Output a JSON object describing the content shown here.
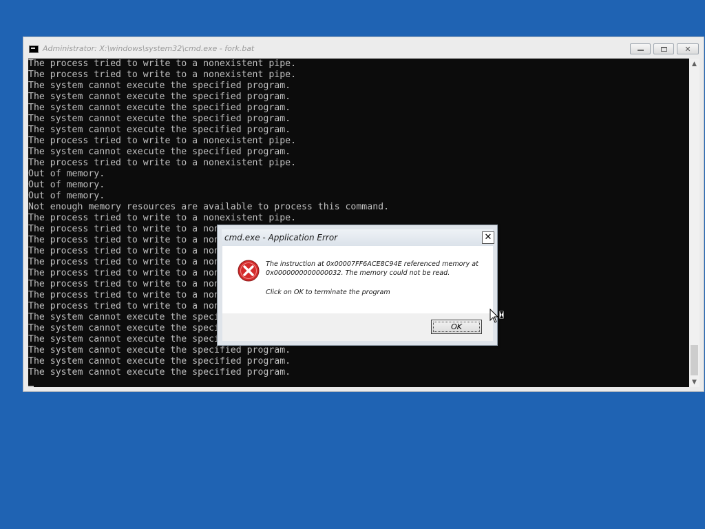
{
  "cmd_window": {
    "title": "Administrator: X:\\windows\\system32\\cmd.exe - fork.bat",
    "lines": [
      "The process tried to write to a nonexistent pipe.",
      "The process tried to write to a nonexistent pipe.",
      "The system cannot execute the specified program.",
      "The system cannot execute the specified program.",
      "The system cannot execute the specified program.",
      "The system cannot execute the specified program.",
      "The system cannot execute the specified program.",
      "The process tried to write to a nonexistent pipe.",
      "The system cannot execute the specified program.",
      "The process tried to write to a nonexistent pipe.",
      "Out of memory.",
      "Out of memory.",
      "Out of memory.",
      "Not enough memory resources are available to process this command.",
      "The process tried to write to a nonexistent pipe.",
      "The process tried to write to a nonexistent pipe.",
      "The process tried to write to a nonexistent pipe.",
      "The process tried to write to a nonexistent pipe.",
      "The process tried to write to a nonexistent pipe.",
      "The process tried to write to a nonexistent pipe.",
      "The process tried to write to a nonexistent pipe.",
      "The process tried to write to a nonexistent pipe.",
      "The process tried to write to a nonexistent pipe.",
      "The system cannot execute the specified program.",
      "The system cannot execute the specified program.",
      "The system cannot execute the specified program.",
      "The system cannot execute the specified program.",
      "The system cannot execute the specified program.",
      "The system cannot execute the specified program."
    ]
  },
  "dialog": {
    "title": "cmd.exe - Application Error",
    "close_label": "✕",
    "message": "The instruction at 0x00007FF6ACE8C94E referenced memory at 0x0000000000000032. The memory could not be read.",
    "instruction": "Click on OK to terminate the program",
    "ok_label": "OK"
  },
  "colors": {
    "desktop": "#1f63b3",
    "console_bg": "#0c0c0c",
    "console_text": "#c0c0c0",
    "error_red": "#d42b2b"
  },
  "icons": {
    "app": "cmd-icon",
    "error": "error-icon",
    "pointer": "busy-pointer-icon"
  }
}
